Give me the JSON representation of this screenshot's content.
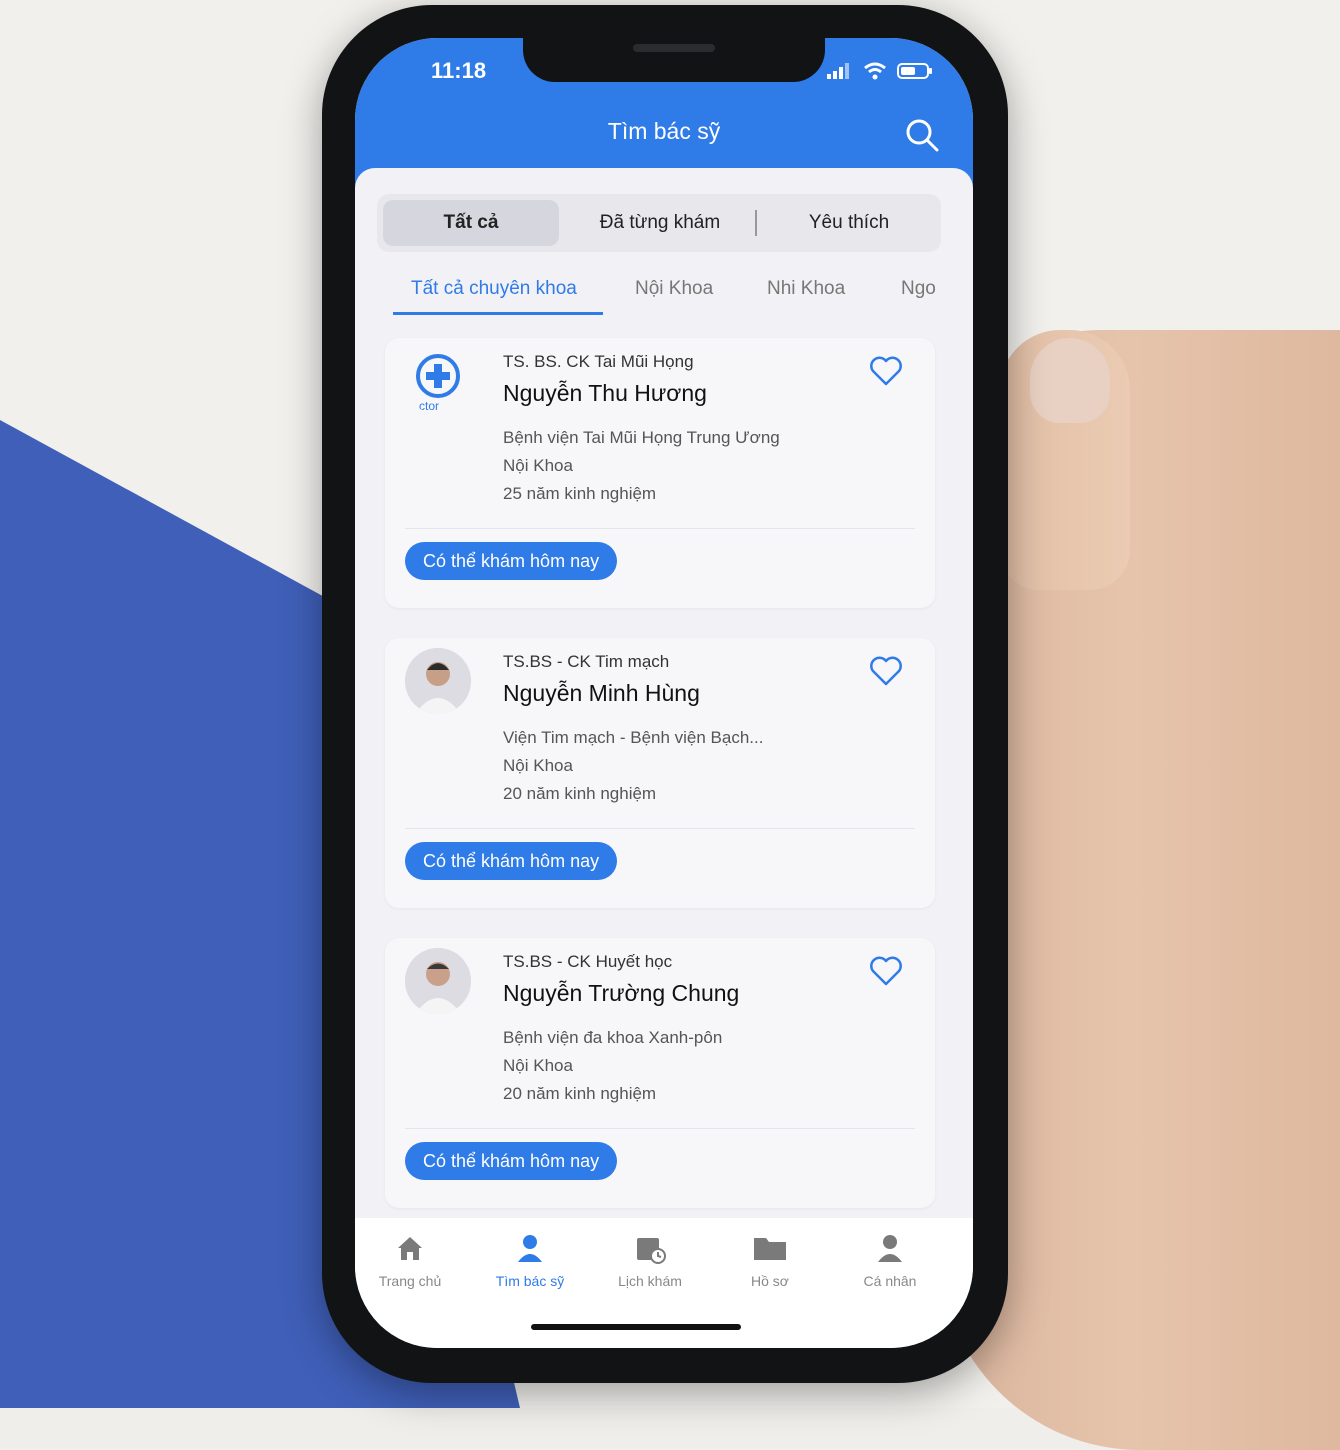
{
  "status": {
    "time": "11:18"
  },
  "header": {
    "title": "Tìm bác sỹ"
  },
  "segments": [
    "Tất cả",
    "Đã từng khám",
    "Yêu thích"
  ],
  "specialties": [
    "Tất cả chuyên khoa",
    "Nội Khoa",
    "Nhi Khoa",
    "Ngo"
  ],
  "doctors": [
    {
      "title": "TS. BS. CK Tai Mũi Họng",
      "name": "Nguyễn Thu Hương",
      "hospital": "Bệnh viện Tai Mũi Họng Trung Ương",
      "department": "Nội Khoa",
      "experience": "25 năm kinh nghiệm",
      "badge": "Có thể khám hôm nay",
      "logo_text": "ctor"
    },
    {
      "title": "TS.BS - CK Tim mạch",
      "name": "Nguyễn Minh Hùng",
      "hospital": "Viện Tim mạch - Bệnh viện Bạch...",
      "department": "Nội Khoa",
      "experience": "20 năm kinh nghiệm",
      "badge": "Có thể khám hôm nay"
    },
    {
      "title": "TS.BS - CK Huyết học",
      "name": "Nguyễn Trường Chung",
      "hospital": "Bệnh viện đa khoa Xanh-pôn",
      "department": "Nội Khoa",
      "experience": "20 năm kinh nghiệm",
      "badge": "Có thể khám hôm nay"
    }
  ],
  "tabbar": [
    {
      "label": "Trang chủ",
      "icon": "home-icon"
    },
    {
      "label": "Tìm bác sỹ",
      "icon": "doctor-icon"
    },
    {
      "label": "Lịch khám",
      "icon": "calendar-icon"
    },
    {
      "label": "Hồ sơ",
      "icon": "folder-icon"
    },
    {
      "label": "Cá nhân",
      "icon": "person-icon"
    }
  ],
  "colors": {
    "primary": "#2f7be8"
  }
}
